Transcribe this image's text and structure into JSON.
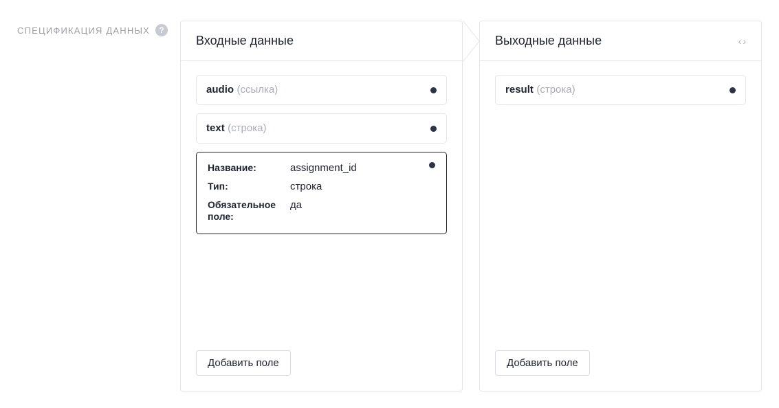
{
  "spec_label": "СПЕЦИФИКАЦИЯ ДАННЫХ",
  "input_panel": {
    "title": "Входные данные",
    "fields": [
      {
        "name": "audio",
        "type_label": "ссылка"
      },
      {
        "name": "text",
        "type_label": "строка"
      }
    ],
    "expanded_field": {
      "labels": {
        "name": "Название:",
        "type": "Тип:",
        "required": "Обязательное поле:"
      },
      "values": {
        "name": "assignment_id",
        "type": "строка",
        "required": "да"
      }
    },
    "add_button": "Добавить поле"
  },
  "output_panel": {
    "title": "Выходные данные",
    "fields": [
      {
        "name": "result",
        "type_label": "строка"
      }
    ],
    "add_button": "Добавить поле"
  }
}
